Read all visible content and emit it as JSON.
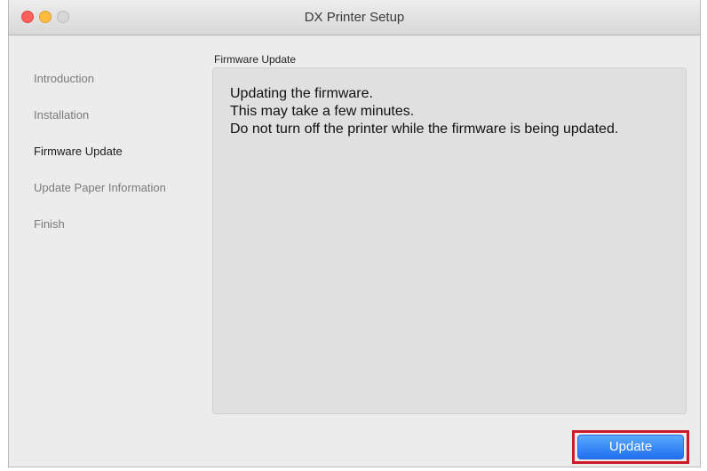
{
  "window": {
    "title": "DX Printer Setup"
  },
  "sidebar": {
    "items": [
      {
        "label": "Introduction",
        "active": false
      },
      {
        "label": "Installation",
        "active": false
      },
      {
        "label": "Firmware Update",
        "active": true
      },
      {
        "label": "Update Paper Information",
        "active": false
      },
      {
        "label": "Finish",
        "active": false
      }
    ]
  },
  "main": {
    "section_title": "Firmware Update",
    "message_lines": [
      "Updating the firmware.",
      "This may take a few minutes.",
      "Do not turn off the printer while the firmware is being updated."
    ]
  },
  "footer": {
    "update_label": "Update"
  },
  "colors": {
    "close": "#fc605c",
    "minimize": "#fdbc40",
    "zoom_disabled": "#d7d7d7",
    "accent": "#1f6ff0",
    "highlight": "#d0182b"
  }
}
